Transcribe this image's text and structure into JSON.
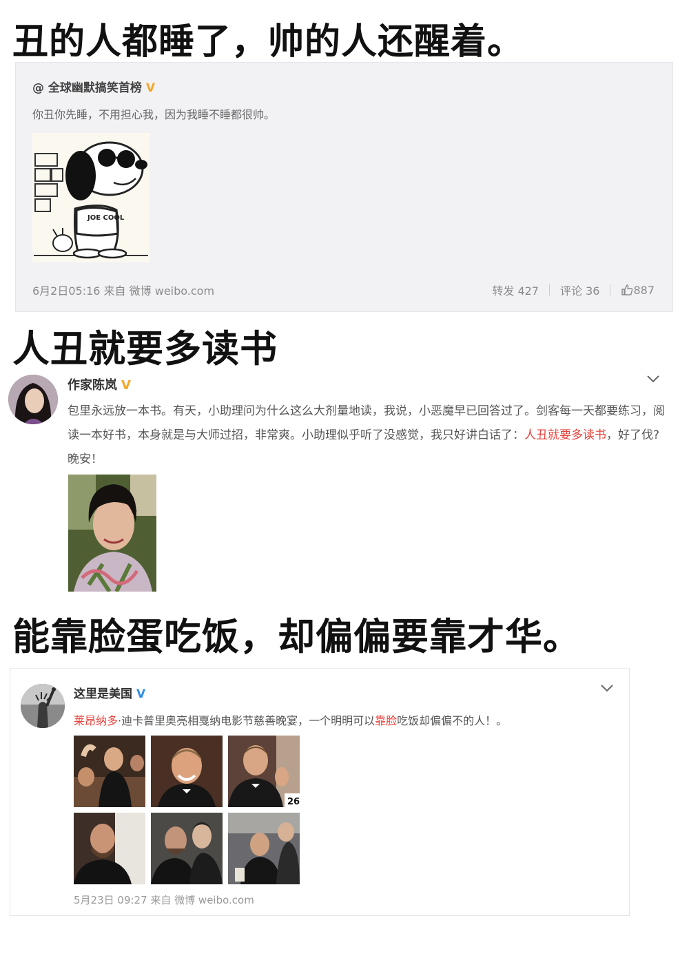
{
  "captions": {
    "c1": "丑的人都睡了，帅的人还醒着。",
    "c2": "人丑就要多读书",
    "c3": "能靠脸蛋吃饭，却偏偏要靠才华。"
  },
  "post1": {
    "author": "@ 全球幽默搞笑首榜",
    "badge": "V",
    "text": "你丑你先睡，不用担心我，因为我睡不睡都很帅。",
    "meta": "6月2日05:16 来自 微博 weibo.com",
    "repost": "转发 427",
    "comment": "评论  36",
    "like": "887",
    "image_text": "JOE COOL"
  },
  "post2": {
    "author": "作家陈岚",
    "badge": "V",
    "text_before": "包里永远放一本书。有天，小助理问为什么这么大剂量地读，我说，小恶魔早已回答过了。剑客每一天都要练习，阅读一本好书，本身就是与大师过招，非常爽。小助理似乎听了没感觉，我只好讲白话了：",
    "text_highlight": "人丑就要多读书",
    "text_after": "，好了伐?晚安！"
  },
  "post3": {
    "author": "这里是美国",
    "badge": "V",
    "text_name": "莱昂纳多",
    "text_mid": "·迪卡普里奥亮相戛纳电影节慈善晚宴，一个明明可以",
    "text_highlight": "靠脸",
    "text_after": "吃饭却偏偏不的人！。",
    "meta": "5月23日 09:27 来自 微博 weibo.com",
    "image_number": "26"
  },
  "colors": {
    "verified_orange": "#f5a623",
    "verified_blue": "#2f8fe8",
    "highlight_red": "#e8403a"
  }
}
